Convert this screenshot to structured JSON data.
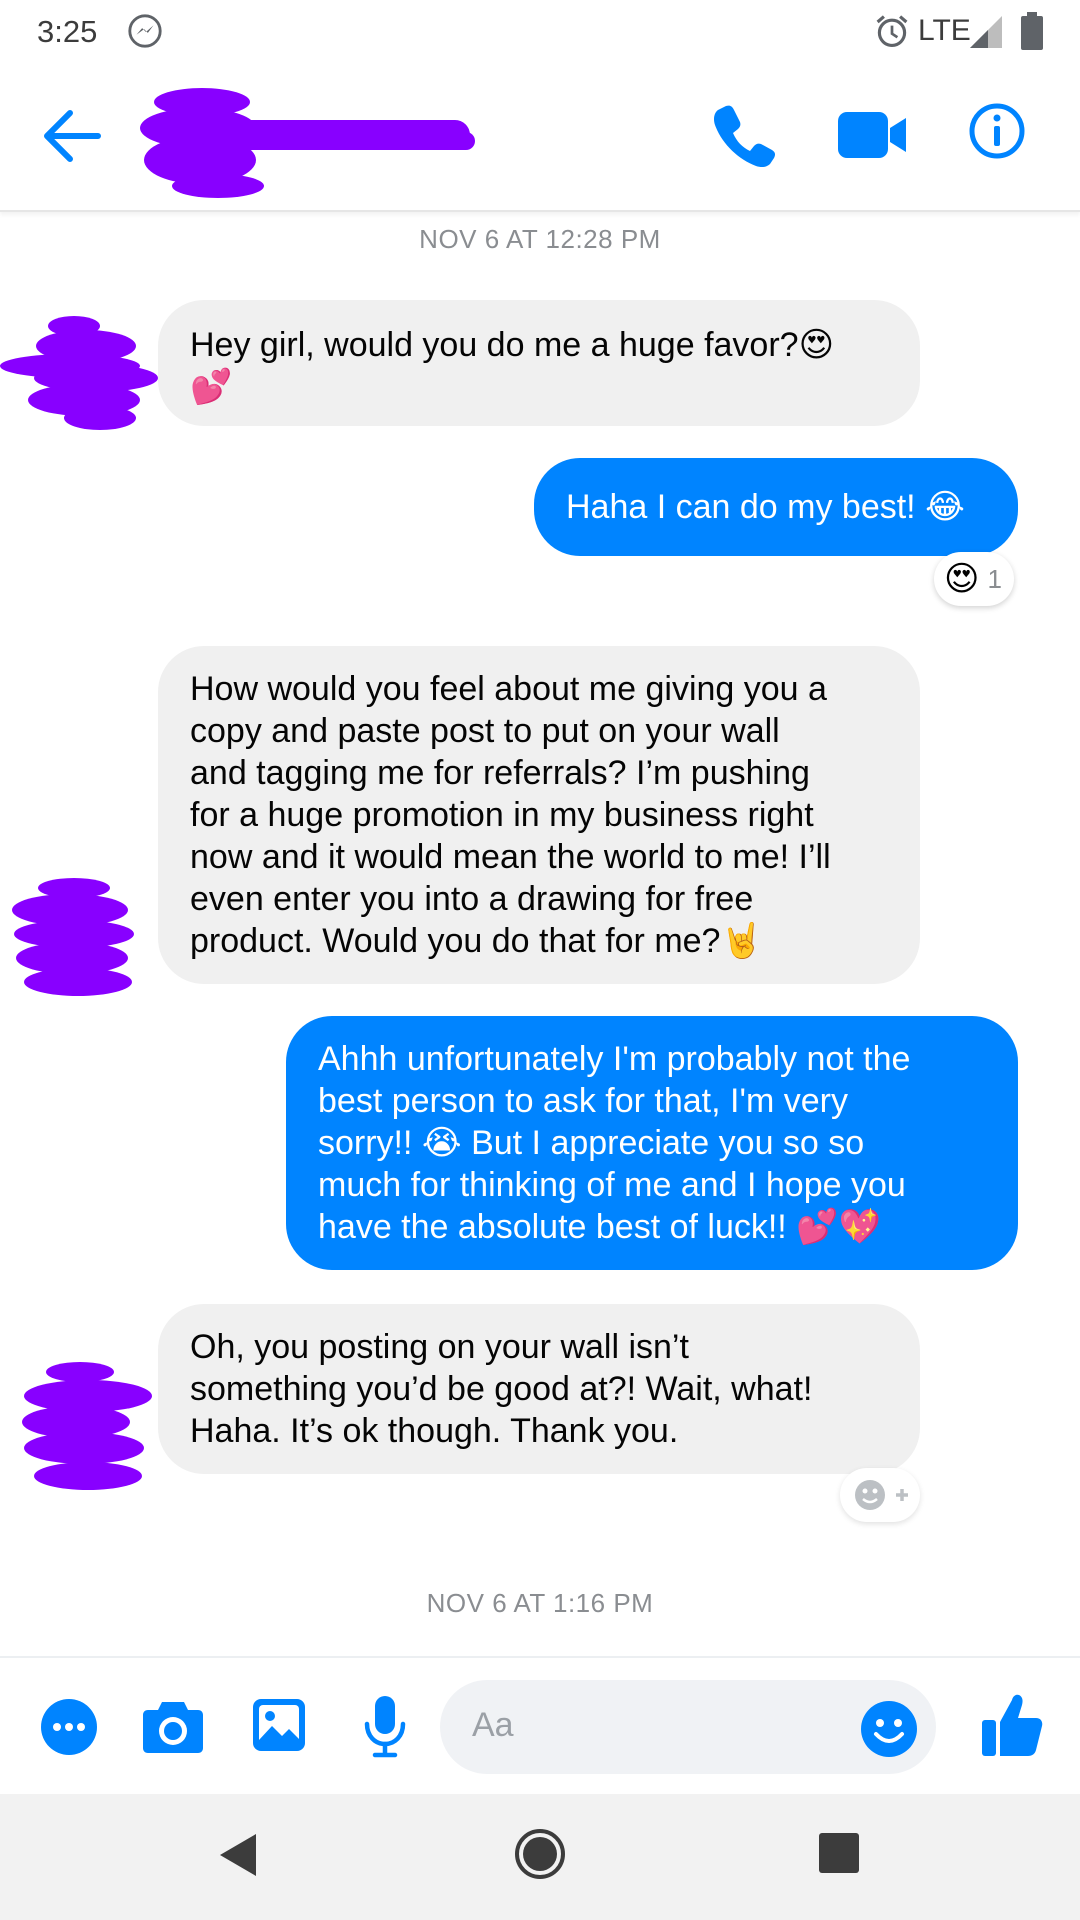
{
  "status_bar": {
    "time": "3:25",
    "network": "LTE",
    "icons": [
      "messenger-icon",
      "alarm-icon",
      "signal-icon",
      "battery-icon"
    ]
  },
  "header": {
    "contact_name": "",
    "contact_name_redacted": true,
    "actions": [
      "back-arrow-icon",
      "phone-call-icon",
      "video-call-icon",
      "info-icon"
    ],
    "accent_color": "#0084ff"
  },
  "messages": [
    {
      "type": "timestamp",
      "text": "NOV 6 AT 12:28 PM"
    },
    {
      "type": "incoming",
      "text": "Hey girl, would you do me a huge favor?😍\n💕"
    },
    {
      "type": "outgoing",
      "text": "Haha I can do my best! 😂",
      "reaction": {
        "emoji": "😍",
        "count": "1"
      }
    },
    {
      "type": "incoming",
      "text": "How would you feel about me giving you a\ncopy and paste post to put on your wall\nand tagging me for referrals? I’m pushing\nfor a huge promotion in my business right\nnow and it would mean the world to me! I’ll\neven enter you into a drawing for free\nproduct. Would you do that for me?🤘"
    },
    {
      "type": "outgoing",
      "text": "Ahhh unfortunately I'm probably not the\nbest person to ask for that, I'm very\nsorry!! 😭 But I appreciate you so so\nmuch for thinking of me and I hope you\nhave the absolute best of luck!! 💕💖"
    },
    {
      "type": "incoming",
      "text": "Oh, you posting on your wall isn’t\nsomething you’d be good at?! Wait, what!\nHaha. It’s ok though. Thank you."
    },
    {
      "type": "timestamp",
      "text": "NOV 6 AT 1:16 PM"
    }
  ],
  "composer": {
    "placeholder": "Aa",
    "icons": [
      "more-icon",
      "camera-icon",
      "gallery-icon",
      "microphone-icon",
      "emoji-icon",
      "like-icon"
    ]
  },
  "nav_bar": {
    "icons": [
      "back-triangle-icon",
      "home-circle-icon",
      "recents-square-icon"
    ]
  },
  "colors": {
    "bubble_out": "#0084ff",
    "bubble_in": "#f0f0f0",
    "redaction": "#8800ff",
    "timestamp": "#8a8d91"
  }
}
